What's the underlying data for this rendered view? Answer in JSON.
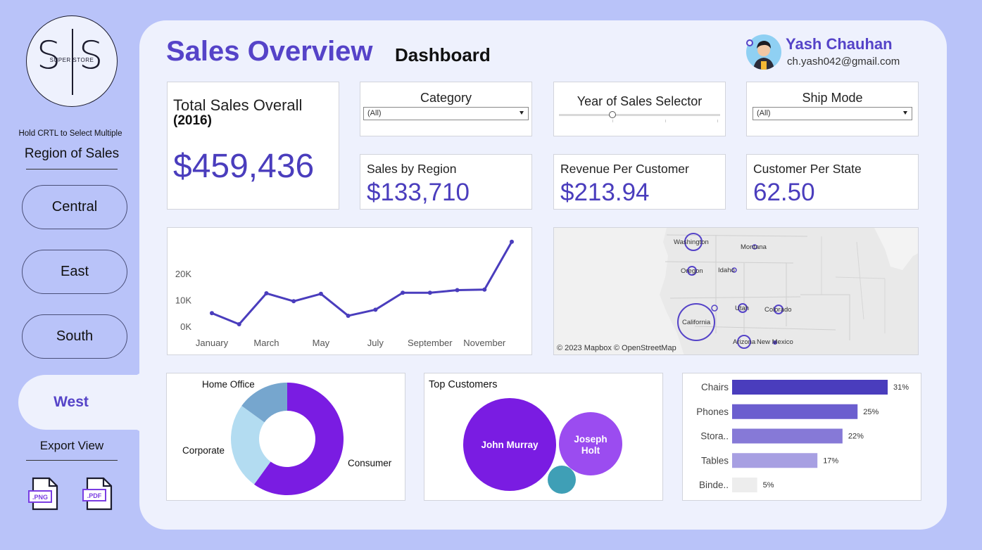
{
  "sidebar": {
    "logo_letter_left": "S",
    "logo_letter_right": "S",
    "logo_text": "SUPER STORE",
    "hint": "Hold CRTL to Select Multiple",
    "region_title": "Region of Sales",
    "regions": [
      "Central",
      "East",
      "South",
      "West"
    ],
    "active_region": "West",
    "export_title": "Export View",
    "export_png": ".PNG",
    "export_pdf": ".PDF"
  },
  "header": {
    "title": "Sales Overview",
    "subtitle": "Dashboard",
    "user_name": "Yash Chauhan",
    "user_email": "ch.yash042@gmail.com"
  },
  "kpis": {
    "total_label": "Total Sales Overall",
    "total_year": "(2016)",
    "total_value": "$459,436",
    "region_label": "Sales by Region",
    "region_value": "$133,710",
    "rpc_label": "Revenue Per Customer",
    "rpc_value": "$213.94",
    "cps_label": "Customer Per State",
    "cps_value": "62.50"
  },
  "filters": {
    "category_title": "Category",
    "category_value": "(All)",
    "year_title": "Year of Sales Selector",
    "year_position": 0.33,
    "shipmode_title": "Ship Mode",
    "shipmode_value": "(All)"
  },
  "map": {
    "attribution": "© 2023 Mapbox  © OpenStreetMap",
    "states": [
      "Washington",
      "Montana",
      "Oregon",
      "Idaho",
      "Utah",
      "Colorado",
      "California",
      "Arizona",
      "New Mexico"
    ]
  },
  "top_customers": {
    "title": "Top Customers",
    "names": [
      "John Murray",
      "Joseph Holt"
    ]
  },
  "colors": {
    "accent": "#5543c8",
    "sidebar_bg": "#b9c3f9",
    "panel_bg": "#eef1fd",
    "line": "#4a3dbd"
  },
  "chart_data": [
    {
      "type": "line",
      "x": [
        "January",
        "February",
        "March",
        "April",
        "May",
        "June",
        "July",
        "August",
        "September",
        "October",
        "November",
        "December"
      ],
      "tick_labels": [
        "January",
        "March",
        "May",
        "July",
        "September",
        "November"
      ],
      "values": [
        5000,
        800,
        12500,
        9500,
        12300,
        4000,
        6300,
        12700,
        12700,
        13700,
        13900,
        32000
      ],
      "yticks": [
        0,
        10000,
        20000
      ],
      "ytick_labels": [
        "0K",
        "10K",
        "20K"
      ],
      "ylim": [
        0,
        33000
      ],
      "title": "",
      "xlabel": "",
      "ylabel": ""
    },
    {
      "type": "pie",
      "donut": true,
      "categories": [
        "Consumer",
        "Corporate",
        "Home Office"
      ],
      "values": [
        60,
        25,
        15
      ],
      "colors": [
        "#7a1ce2",
        "#b3dcf1",
        "#76a6ce"
      ]
    },
    {
      "type": "bar",
      "orientation": "horizontal",
      "categories": [
        "Chairs",
        "Phones",
        "Stora..",
        "Tables",
        "Binde.."
      ],
      "values": [
        31,
        25,
        22,
        17,
        5
      ],
      "value_labels": [
        "31%",
        "25%",
        "22%",
        "17%",
        "5%"
      ],
      "colors": [
        "#4a3dbd",
        "#6b5ecf",
        "#8679d7",
        "#a79fe2",
        "#ededed"
      ],
      "xlim": [
        0,
        31
      ]
    }
  ]
}
